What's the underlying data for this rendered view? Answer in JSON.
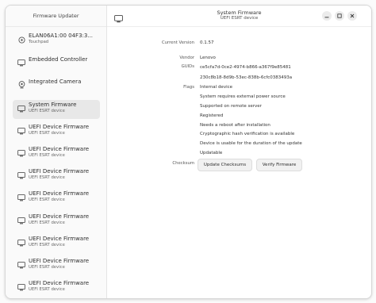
{
  "sidebar": {
    "title": "Firmware Updater",
    "devices": [
      {
        "name": "ELAN06A1:00 04F3:3...",
        "sub": "Touchpad",
        "icon": "touchpad-icon"
      },
      {
        "name": "Embedded Controller",
        "sub": "",
        "icon": "computer-icon"
      },
      {
        "name": "Integrated Camera",
        "sub": "",
        "icon": "camera-icon"
      },
      {
        "name": "System Firmware",
        "sub": "UEFI ESRT device",
        "icon": "computer-icon",
        "selected": true
      },
      {
        "name": "UEFI Device Firmware",
        "sub": "UEFI ESRT device",
        "icon": "computer-icon"
      },
      {
        "name": "UEFI Device Firmware",
        "sub": "UEFI ESRT device",
        "icon": "computer-icon"
      },
      {
        "name": "UEFI Device Firmware",
        "sub": "UEFI ESRT device",
        "icon": "computer-icon"
      },
      {
        "name": "UEFI Device Firmware",
        "sub": "UEFI ESRT device",
        "icon": "computer-icon"
      },
      {
        "name": "UEFI Device Firmware",
        "sub": "UEFI ESRT device",
        "icon": "computer-icon"
      },
      {
        "name": "UEFI Device Firmware",
        "sub": "UEFI ESRT device",
        "icon": "computer-icon"
      },
      {
        "name": "UEFI Device Firmware",
        "sub": "UEFI ESRT device",
        "icon": "computer-icon"
      },
      {
        "name": "UEFI Device Firmware",
        "sub": "UEFI ESRT device",
        "icon": "computer-icon"
      }
    ]
  },
  "header": {
    "title": "System Firmware",
    "subtitle": "UEFI ESRT device"
  },
  "details": {
    "current_version_label": "Current Version",
    "current_version": "0.1.57",
    "vendor_label": "Vendor",
    "vendor": "Lenovo",
    "guids_label": "GUIDs",
    "guids": [
      "ce5cfa7d-0ce2-4974-b866-a367f9e85481",
      "230c8b18-8d9b-53ec-838b-6cfc0383493a"
    ],
    "flags_label": "Flags",
    "flags": [
      "Internal device",
      "System requires external power source",
      "Supported on remote server",
      "Registered",
      "Needs a reboot after installation",
      "Cryptographic hash verification is available",
      "Device is usable for the duration of the update",
      "Updatable"
    ],
    "checksum_label": "Checksum",
    "update_checksums_button": "Update Checksums",
    "verify_firmware_button": "Verify Firmware"
  }
}
